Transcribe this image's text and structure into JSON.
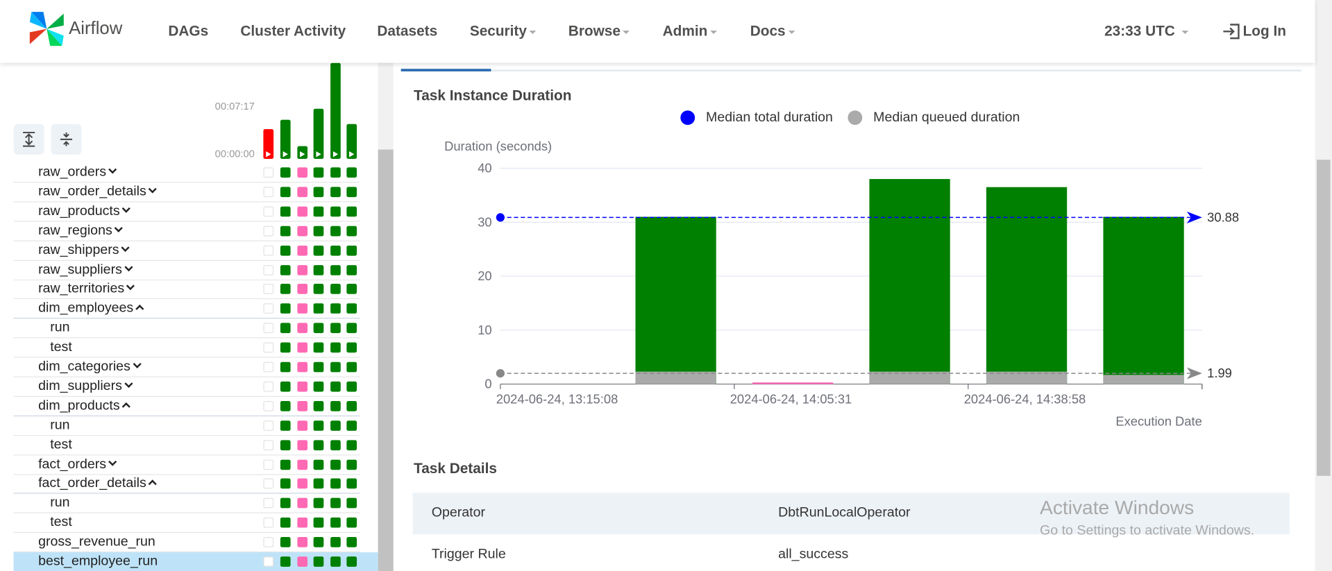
{
  "app": {
    "brand": "Airflow"
  },
  "nav": {
    "items": [
      "DAGs",
      "Cluster Activity",
      "Datasets",
      "Security",
      "Browse",
      "Admin",
      "Docs"
    ],
    "time": "23:33 UTC",
    "login": "Log In"
  },
  "grid": {
    "duration_top": "00:07:17",
    "duration_bottom": "00:00:00",
    "run_durations": [
      {
        "status": "failed",
        "color": "#ff0000",
        "value": 0.31
      },
      {
        "status": "success",
        "color": "#008000",
        "value": 0.41
      },
      {
        "status": "success",
        "color": "#008000",
        "value": 0.13
      },
      {
        "status": "success",
        "color": "#008000",
        "value": 0.52
      },
      {
        "status": "success",
        "color": "#008000",
        "value": 1.0
      },
      {
        "status": "success",
        "color": "#008000",
        "value": 0.36
      }
    ],
    "status_colors": {
      "none": "#ffffff",
      "success": "#008000",
      "upstream_failed": "#ff69b4"
    },
    "tasks": [
      {
        "name": "raw_orders",
        "toggle": "down",
        "level": 0
      },
      {
        "name": "raw_order_details",
        "toggle": "down",
        "level": 0
      },
      {
        "name": "raw_products",
        "toggle": "down",
        "level": 0
      },
      {
        "name": "raw_regions",
        "toggle": "down",
        "level": 0
      },
      {
        "name": "raw_shippers",
        "toggle": "down",
        "level": 0
      },
      {
        "name": "raw_suppliers",
        "toggle": "down",
        "level": 0
      },
      {
        "name": "raw_territories",
        "toggle": "down",
        "level": 0
      },
      {
        "name": "dim_employees",
        "toggle": "up",
        "level": 0
      },
      {
        "name": "run",
        "toggle": "",
        "level": 1
      },
      {
        "name": "test",
        "toggle": "",
        "level": 1
      },
      {
        "name": "dim_categories",
        "toggle": "down",
        "level": 0
      },
      {
        "name": "dim_suppliers",
        "toggle": "down",
        "level": 0
      },
      {
        "name": "dim_products",
        "toggle": "up",
        "level": 0
      },
      {
        "name": "run",
        "toggle": "",
        "level": 1
      },
      {
        "name": "test",
        "toggle": "",
        "level": 1
      },
      {
        "name": "fact_orders",
        "toggle": "down",
        "level": 0
      },
      {
        "name": "fact_order_details",
        "toggle": "up",
        "level": 0
      },
      {
        "name": "run",
        "toggle": "",
        "level": 1
      },
      {
        "name": "test",
        "toggle": "",
        "level": 1
      },
      {
        "name": "gross_revenue_run",
        "toggle": "",
        "level": 0
      },
      {
        "name": "best_employee_run",
        "toggle": "",
        "level": 0,
        "selected": true
      }
    ],
    "instance_states": [
      "none",
      "success",
      "upstream_failed",
      "success",
      "success",
      "success"
    ]
  },
  "duration_section": {
    "title": "Task Instance Duration"
  },
  "chart_data": {
    "type": "bar",
    "title": "",
    "legend": [
      "Median total duration",
      "Median queued duration"
    ],
    "legend_colors": [
      "#0000ff",
      "#aaaaaa"
    ],
    "ylabel": "Duration (seconds)",
    "xlabel": "Execution Date",
    "ylim": [
      0,
      40
    ],
    "yticks": [
      0,
      10,
      20,
      30,
      40
    ],
    "categories": [
      "2024-06-24, 13:15:08",
      "",
      "2024-06-24, 14:05:31",
      "",
      "2024-06-24, 14:38:58",
      ""
    ],
    "xtick_labels": [
      "2024-06-24, 13:15:08",
      "2024-06-24, 14:05:31",
      "2024-06-24, 14:38:58"
    ],
    "series": [
      {
        "name": "Median queued duration",
        "values": [
          null,
          2.3,
          0.2,
          2.3,
          2.3,
          1.7
        ],
        "colors": [
          "#aaaaaa",
          "#aaaaaa",
          "#ff69b4",
          "#aaaaaa",
          "#aaaaaa",
          "#aaaaaa"
        ]
      },
      {
        "name": "Median total duration",
        "values": [
          null,
          31.0,
          0.3,
          38.0,
          36.5,
          31.0
        ],
        "colors": [
          "#008000",
          "#008000",
          "#ff69b4",
          "#008000",
          "#008000",
          "#008000"
        ]
      }
    ],
    "median_total": 30.88,
    "median_total_label": "30.88",
    "median_queued": 1.99,
    "median_queued_label": "1.99"
  },
  "details": {
    "title": "Task Details",
    "rows": [
      {
        "key": "Operator",
        "value": "DbtRunLocalOperator"
      },
      {
        "key": "Trigger Rule",
        "value": "all_success"
      }
    ]
  },
  "watermark": {
    "line1": "Activate Windows",
    "line2": "Go to Settings to activate Windows."
  }
}
